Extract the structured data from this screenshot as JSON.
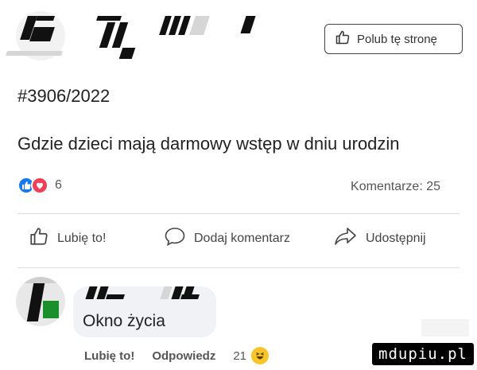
{
  "header": {
    "like_page_button": "Polub tę stronę"
  },
  "post": {
    "number": "#3906/2022",
    "text": "Gdzie dzieci mają darmowy wstęp w dniu urodzin",
    "reaction_count": "6",
    "comments": "Komentarze: 25"
  },
  "actions": {
    "like": "Lubię to!",
    "comment": "Dodaj komentarz",
    "share": "Udostępnij"
  },
  "comment": {
    "text": "Okno życia",
    "like": "Lubię to!",
    "reply": "Odpowiedz",
    "reaction_count": "21"
  },
  "watermark": "mdupiu.pl",
  "colors": {
    "like_blue": "#1877f2",
    "love_red": "#f33e58",
    "haha_yellow": "#f7c42a"
  }
}
